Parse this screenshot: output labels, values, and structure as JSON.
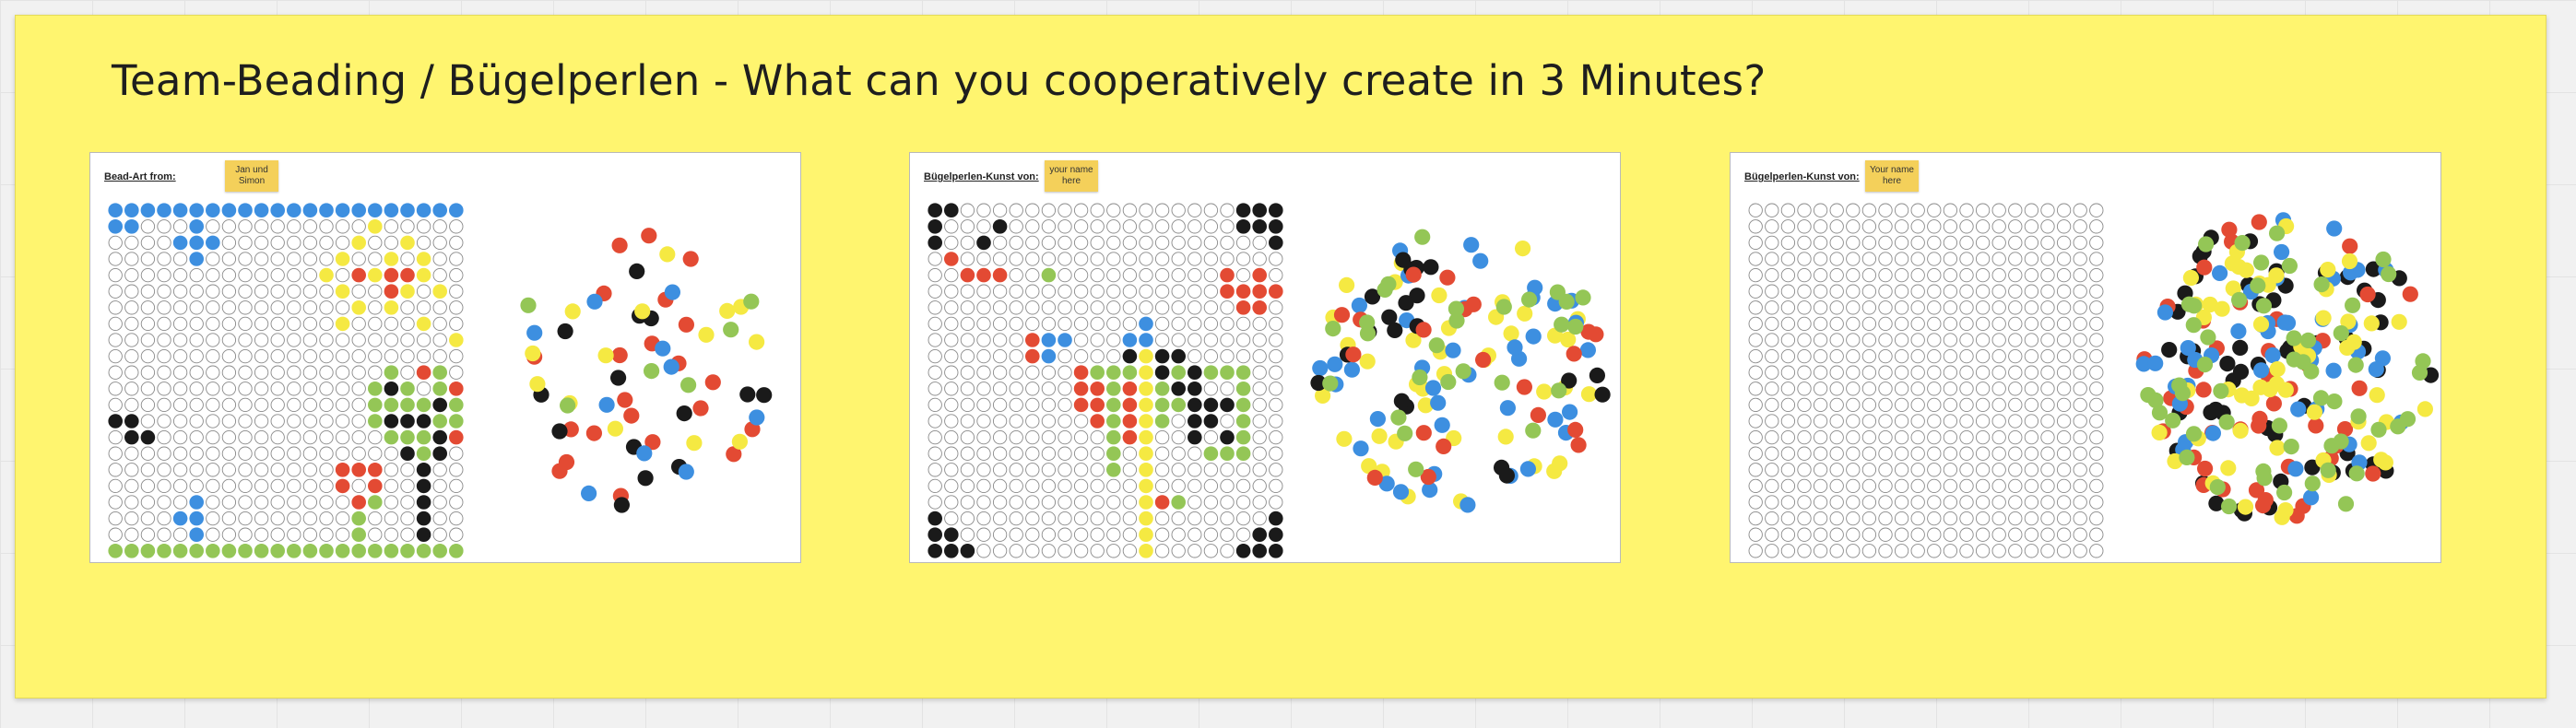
{
  "board": {
    "title": "Team-Beading / Bügelperlen - What can you cooperatively create in 3 Minutes?"
  },
  "colors": {
    "frame": "#fff56f",
    "blue": "#3d8fe0",
    "red": "#e34a33",
    "yellow": "#f5e942",
    "green": "#94c656",
    "black": "#1a1a1a",
    "empty_ring": "#8a8a8a",
    "note": "#f4d05a"
  },
  "cards": [
    {
      "label": "Bead-Art from:",
      "note_lines": [
        "Jan und",
        "Simon"
      ],
      "board_image": "sun, tree, flower and sky on a bead board"
    },
    {
      "label": "Bügelperlen-Kunst von:",
      "note_lines": [
        "your name",
        "here"
      ],
      "board_image": "corners, heart and figure on a bead board"
    },
    {
      "label": "Bügelperlen-Kunst von:",
      "note_lines": [
        "Your name",
        "here"
      ],
      "board_image": "empty bead board"
    }
  ]
}
